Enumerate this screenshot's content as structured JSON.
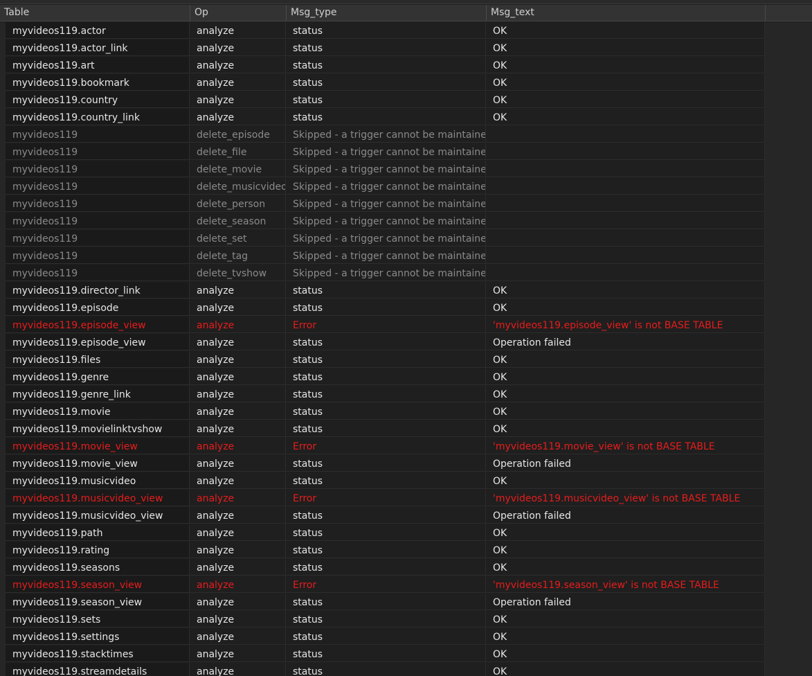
{
  "columns": [
    "Table",
    "Op",
    "Msg_type",
    "Msg_text"
  ],
  "rows": [
    {
      "table": "myvideos119.actor",
      "op": "analyze",
      "msg_type": "status",
      "msg_text": "OK",
      "kind": "normal"
    },
    {
      "table": "myvideos119.actor_link",
      "op": "analyze",
      "msg_type": "status",
      "msg_text": "OK",
      "kind": "normal"
    },
    {
      "table": "myvideos119.art",
      "op": "analyze",
      "msg_type": "status",
      "msg_text": "OK",
      "kind": "normal"
    },
    {
      "table": "myvideos119.bookmark",
      "op": "analyze",
      "msg_type": "status",
      "msg_text": "OK",
      "kind": "normal"
    },
    {
      "table": "myvideos119.country",
      "op": "analyze",
      "msg_type": "status",
      "msg_text": "OK",
      "kind": "normal"
    },
    {
      "table": "myvideos119.country_link",
      "op": "analyze",
      "msg_type": "status",
      "msg_text": "OK",
      "kind": "normal"
    },
    {
      "table": "myvideos119",
      "op": "delete_episode",
      "msg_type": "Skipped - a trigger cannot be maintained.",
      "msg_text": "",
      "kind": "skipped"
    },
    {
      "table": "myvideos119",
      "op": "delete_file",
      "msg_type": "Skipped - a trigger cannot be maintained.",
      "msg_text": "",
      "kind": "skipped"
    },
    {
      "table": "myvideos119",
      "op": "delete_movie",
      "msg_type": "Skipped - a trigger cannot be maintained.",
      "msg_text": "",
      "kind": "skipped"
    },
    {
      "table": "myvideos119",
      "op": "delete_musicvideo",
      "msg_type": "Skipped - a trigger cannot be maintained.",
      "msg_text": "",
      "kind": "skipped"
    },
    {
      "table": "myvideos119",
      "op": "delete_person",
      "msg_type": "Skipped - a trigger cannot be maintained.",
      "msg_text": "",
      "kind": "skipped"
    },
    {
      "table": "myvideos119",
      "op": "delete_season",
      "msg_type": "Skipped - a trigger cannot be maintained.",
      "msg_text": "",
      "kind": "skipped"
    },
    {
      "table": "myvideos119",
      "op": "delete_set",
      "msg_type": "Skipped - a trigger cannot be maintained.",
      "msg_text": "",
      "kind": "skipped"
    },
    {
      "table": "myvideos119",
      "op": "delete_tag",
      "msg_type": "Skipped - a trigger cannot be maintained.",
      "msg_text": "",
      "kind": "skipped"
    },
    {
      "table": "myvideos119",
      "op": "delete_tvshow",
      "msg_type": "Skipped - a trigger cannot be maintained.",
      "msg_text": "",
      "kind": "skipped"
    },
    {
      "table": "myvideos119.director_link",
      "op": "analyze",
      "msg_type": "status",
      "msg_text": "OK",
      "kind": "normal"
    },
    {
      "table": "myvideos119.episode",
      "op": "analyze",
      "msg_type": "status",
      "msg_text": "OK",
      "kind": "normal"
    },
    {
      "table": "myvideos119.episode_view",
      "op": "analyze",
      "msg_type": "Error",
      "msg_text": "'myvideos119.episode_view' is not BASE TABLE",
      "kind": "error"
    },
    {
      "table": "myvideos119.episode_view",
      "op": "analyze",
      "msg_type": "status",
      "msg_text": "Operation failed",
      "kind": "normal"
    },
    {
      "table": "myvideos119.files",
      "op": "analyze",
      "msg_type": "status",
      "msg_text": "OK",
      "kind": "normal"
    },
    {
      "table": "myvideos119.genre",
      "op": "analyze",
      "msg_type": "status",
      "msg_text": "OK",
      "kind": "normal"
    },
    {
      "table": "myvideos119.genre_link",
      "op": "analyze",
      "msg_type": "status",
      "msg_text": "OK",
      "kind": "normal"
    },
    {
      "table": "myvideos119.movie",
      "op": "analyze",
      "msg_type": "status",
      "msg_text": "OK",
      "kind": "normal"
    },
    {
      "table": "myvideos119.movielinktvshow",
      "op": "analyze",
      "msg_type": "status",
      "msg_text": "OK",
      "kind": "normal"
    },
    {
      "table": "myvideos119.movie_view",
      "op": "analyze",
      "msg_type": "Error",
      "msg_text": "'myvideos119.movie_view' is not BASE TABLE",
      "kind": "error"
    },
    {
      "table": "myvideos119.movie_view",
      "op": "analyze",
      "msg_type": "status",
      "msg_text": "Operation failed",
      "kind": "normal"
    },
    {
      "table": "myvideos119.musicvideo",
      "op": "analyze",
      "msg_type": "status",
      "msg_text": "OK",
      "kind": "normal"
    },
    {
      "table": "myvideos119.musicvideo_view",
      "op": "analyze",
      "msg_type": "Error",
      "msg_text": "'myvideos119.musicvideo_view' is not BASE TABLE",
      "kind": "error"
    },
    {
      "table": "myvideos119.musicvideo_view",
      "op": "analyze",
      "msg_type": "status",
      "msg_text": "Operation failed",
      "kind": "normal"
    },
    {
      "table": "myvideos119.path",
      "op": "analyze",
      "msg_type": "status",
      "msg_text": "OK",
      "kind": "normal"
    },
    {
      "table": "myvideos119.rating",
      "op": "analyze",
      "msg_type": "status",
      "msg_text": "OK",
      "kind": "normal"
    },
    {
      "table": "myvideos119.seasons",
      "op": "analyze",
      "msg_type": "status",
      "msg_text": "OK",
      "kind": "normal"
    },
    {
      "table": "myvideos119.season_view",
      "op": "analyze",
      "msg_type": "Error",
      "msg_text": "'myvideos119.season_view' is not BASE TABLE",
      "kind": "error"
    },
    {
      "table": "myvideos119.season_view",
      "op": "analyze",
      "msg_type": "status",
      "msg_text": "Operation failed",
      "kind": "normal"
    },
    {
      "table": "myvideos119.sets",
      "op": "analyze",
      "msg_type": "status",
      "msg_text": "OK",
      "kind": "normal"
    },
    {
      "table": "myvideos119.settings",
      "op": "analyze",
      "msg_type": "status",
      "msg_text": "OK",
      "kind": "normal"
    },
    {
      "table": "myvideos119.stacktimes",
      "op": "analyze",
      "msg_type": "status",
      "msg_text": "OK",
      "kind": "normal"
    },
    {
      "table": "myvideos119.streamdetails",
      "op": "analyze",
      "msg_type": "status",
      "msg_text": "OK",
      "kind": "normal"
    }
  ],
  "colors": {
    "background": "#1e1e1e",
    "header": "#333333",
    "text": "#e6e6e6",
    "skipped_text": "#8a8a8a",
    "error_text": "#e81c1c"
  }
}
